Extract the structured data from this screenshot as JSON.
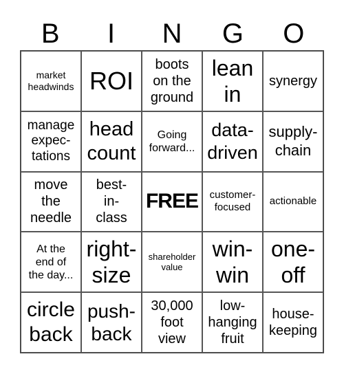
{
  "header": [
    "B",
    "I",
    "N",
    "G",
    "O"
  ],
  "cells": [
    {
      "text": "market\nheadwinds",
      "size": 14
    },
    {
      "text": "ROI",
      "size": 36
    },
    {
      "text": "boots\non the\nground",
      "size": 20
    },
    {
      "text": "lean\nin",
      "size": 32
    },
    {
      "text": "synergy",
      "size": 20
    },
    {
      "text": "manage\nexpec-\ntations",
      "size": 19
    },
    {
      "text": "head\ncount",
      "size": 29
    },
    {
      "text": "Going\nforward...",
      "size": 16
    },
    {
      "text": "data-\ndriven",
      "size": 27
    },
    {
      "text": "supply-\nchain",
      "size": 22
    },
    {
      "text": "move\nthe\nneedle",
      "size": 20
    },
    {
      "text": "best-\nin-\nclass",
      "size": 20
    },
    {
      "text": "FREE",
      "size": 30,
      "free": true
    },
    {
      "text": "customer-\nfocused",
      "size": 15
    },
    {
      "text": "actionable",
      "size": 15
    },
    {
      "text": "At the\nend of\nthe day...",
      "size": 16
    },
    {
      "text": "right-\nsize",
      "size": 32
    },
    {
      "text": "shareholder\nvalue",
      "size": 13
    },
    {
      "text": "win-\nwin",
      "size": 32
    },
    {
      "text": "one-\noff",
      "size": 32
    },
    {
      "text": "circle\nback",
      "size": 30
    },
    {
      "text": "push-\nback",
      "size": 28
    },
    {
      "text": "30,000\nfoot\nview",
      "size": 20
    },
    {
      "text": "low-\nhanging\nfruit",
      "size": 20
    },
    {
      "text": "house-\nkeeping",
      "size": 20
    }
  ]
}
